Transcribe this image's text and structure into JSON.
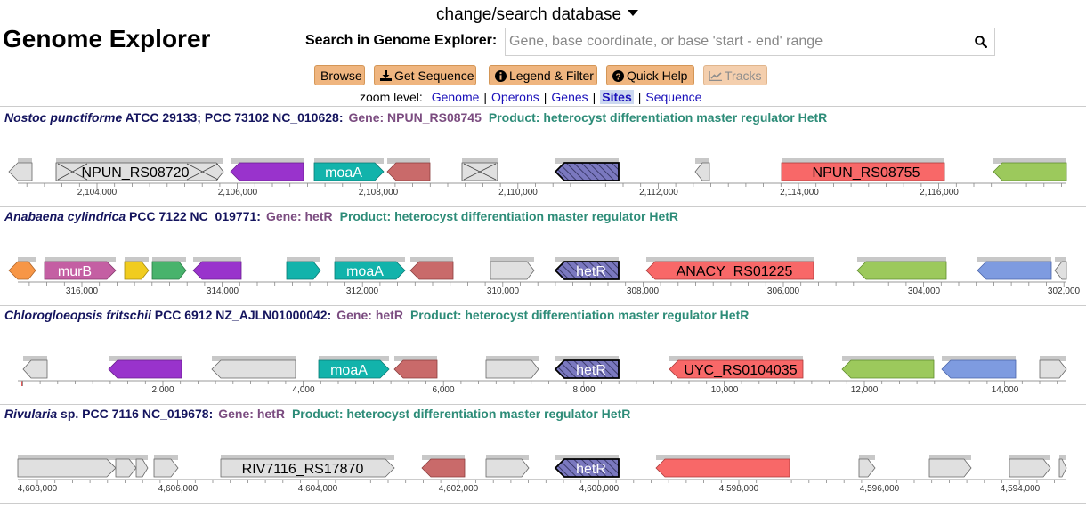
{
  "database_link": "change/search database",
  "app_title": "Genome Explorer",
  "search": {
    "label": "Search in Genome Explorer:",
    "placeholder": "Gene, base coordinate, or base 'start - end' range",
    "value": ""
  },
  "toolbar": {
    "browse": "Browse",
    "get_sequence": "Get Sequence",
    "legend_filter": "Legend & Filter",
    "quick_help": "Quick Help",
    "tracks": "Tracks"
  },
  "zoom": {
    "label": "zoom level:",
    "levels": [
      "Genome",
      "Operons",
      "Genes",
      "Sites",
      "Sequence"
    ],
    "active": "Sites"
  },
  "colors": {
    "purple": "#9933cc",
    "teal": "#12b3ab",
    "rosy": "#c96a6a",
    "hatched": "#7a78bf",
    "red": "#f86868",
    "green": "#9cc95c",
    "blue": "#7e9be0",
    "orange": "#f79646",
    "pink": "#c45fa3",
    "yellow": "#f1cc1f",
    "emerald": "#48b36c",
    "grey": "#e0e0e0"
  },
  "tracks": [
    {
      "organism_italic": "Nostoc punctiforme",
      "organism_rest": " ATCC 29133; PCC 73102 NC_010628:",
      "gene": "Gene: NPUN_RS08745",
      "product": "Product: heterocyst differentiation master regulator HetR",
      "ticks": [
        "2,104,000",
        "2,106,000",
        "2,108,000",
        "2,110,000",
        "2,112,000",
        "2,114,000",
        "2,116,000"
      ],
      "genes": [
        {
          "label": "NPUN_RS08720",
          "color": "grey",
          "dir": "right"
        },
        {
          "label": "",
          "color": "purple",
          "dir": "left"
        },
        {
          "label": "moaA",
          "color": "teal",
          "dir": "right"
        },
        {
          "label": "",
          "color": "rosy",
          "dir": "left"
        },
        {
          "label": "",
          "color": "hatched",
          "dir": "left"
        },
        {
          "label": "NPUN_RS08755",
          "color": "red",
          "dir": "none"
        },
        {
          "label": "",
          "color": "green",
          "dir": "left"
        }
      ]
    },
    {
      "organism_italic": "Anabaena cylindrica",
      "organism_rest": " PCC 7122 NC_019771:",
      "gene": "Gene: hetR",
      "product": "Product: heterocyst differentiation master regulator HetR",
      "ticks": [
        "316,000",
        "314,000",
        "312,000",
        "310,000",
        "308,000",
        "306,000",
        "304,000",
        "302,000"
      ],
      "genes": [
        {
          "label": "",
          "color": "orange",
          "dir": "right"
        },
        {
          "label": "murB",
          "color": "pink",
          "dir": "right"
        },
        {
          "label": "",
          "color": "yellow",
          "dir": "right"
        },
        {
          "label": "",
          "color": "emerald",
          "dir": "right"
        },
        {
          "label": "",
          "color": "purple",
          "dir": "left"
        },
        {
          "label": "",
          "color": "teal",
          "dir": "right"
        },
        {
          "label": "moaA",
          "color": "teal",
          "dir": "right"
        },
        {
          "label": "",
          "color": "rosy",
          "dir": "left"
        },
        {
          "label": "hetR",
          "color": "hatched",
          "dir": "left"
        },
        {
          "label": "ANACY_RS01225",
          "color": "red",
          "dir": "left"
        },
        {
          "label": "",
          "color": "green",
          "dir": "left"
        },
        {
          "label": "",
          "color": "blue",
          "dir": "left"
        }
      ]
    },
    {
      "organism_italic": "Chlorogloeopsis fritschii",
      "organism_rest": " PCC 6912 NZ_AJLN01000042:",
      "gene": "Gene: hetR",
      "product": "Product: heterocyst differentiation master regulator HetR",
      "ticks": [
        "2,000",
        "4,000",
        "6,000",
        "8,000",
        "10,000",
        "12,000",
        "14,000"
      ],
      "genes": [
        {
          "label": "",
          "color": "purple",
          "dir": "left"
        },
        {
          "label": "moaA",
          "color": "teal",
          "dir": "right"
        },
        {
          "label": "",
          "color": "rosy",
          "dir": "left"
        },
        {
          "label": "hetR",
          "color": "hatched",
          "dir": "left"
        },
        {
          "label": "UYC_RS0104035",
          "color": "red",
          "dir": "left"
        },
        {
          "label": "",
          "color": "green",
          "dir": "left"
        },
        {
          "label": "",
          "color": "blue",
          "dir": "left"
        }
      ]
    },
    {
      "organism_italic": "Rivularia",
      "organism_rest": " sp. PCC 7116 NC_019678:",
      "gene": "Gene: hetR",
      "product": "Product: heterocyst differentiation master regulator HetR",
      "ticks": [
        "4,608,000",
        "4,606,000",
        "4,604,000",
        "4,602,000",
        "4,600,000",
        "4,598,000",
        "4,596,000",
        "4,594,000"
      ],
      "genes": [
        {
          "label": "RIV7116_RS17870",
          "color": "grey",
          "dir": "right"
        },
        {
          "label": "",
          "color": "rosy",
          "dir": "left"
        },
        {
          "label": "hetR",
          "color": "hatched",
          "dir": "left"
        },
        {
          "label": "",
          "color": "red",
          "dir": "left"
        }
      ]
    }
  ]
}
